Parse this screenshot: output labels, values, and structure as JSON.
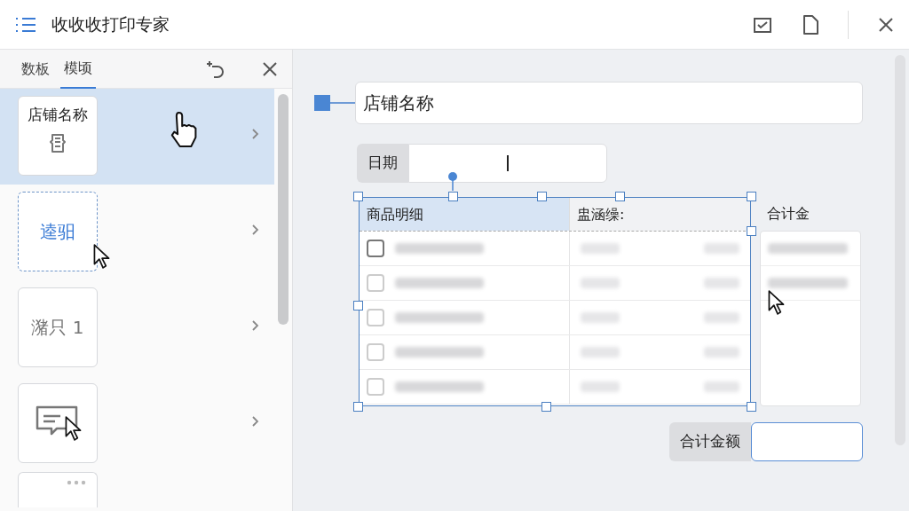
{
  "window": {
    "title": "收收收打印专家"
  },
  "panel_tabs": [
    {
      "label": "数板",
      "selected": false
    },
    {
      "label": "模顷",
      "selected": true
    }
  ],
  "sidebar": {
    "items": [
      {
        "kind": "label-icon",
        "label": "店铺名称",
        "selected": true
      },
      {
        "kind": "dashed",
        "label": "逵驲",
        "selected": false
      },
      {
        "kind": "dotted",
        "label": "潴只 1",
        "selected": false
      },
      {
        "kind": "icon",
        "selected": false
      },
      {
        "kind": "partial",
        "selected": false
      }
    ]
  },
  "canvas": {
    "title_field": {
      "value": "店铺名称"
    },
    "date": {
      "label": "日期"
    },
    "table": {
      "columns": [
        "商品明细",
        "盅涵缲:"
      ],
      "rows": [
        {
          "checked": false
        },
        {
          "checked": false
        },
        {
          "checked": false
        },
        {
          "checked": false
        },
        {
          "checked": false
        }
      ]
    },
    "side_column": {
      "label": "合计金"
    },
    "total": {
      "label": "合计金额"
    }
  }
}
